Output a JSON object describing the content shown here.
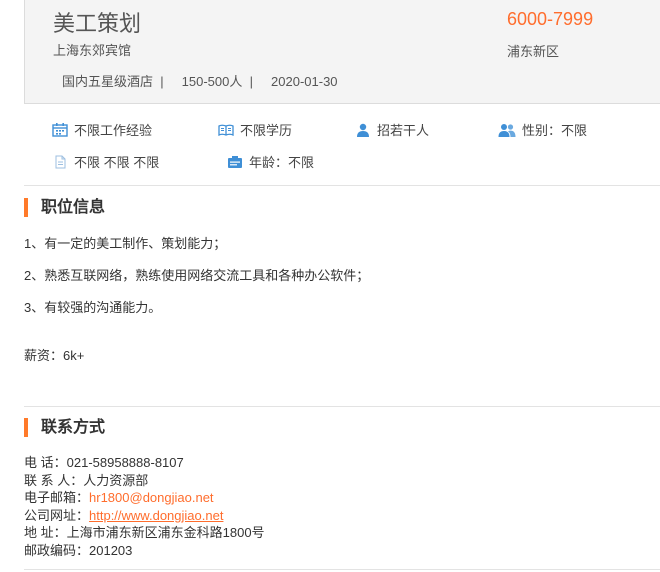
{
  "job": {
    "title": "美工策划",
    "company": "上海东郊宾馆",
    "meta_text": "国内五星级酒店  |     150-500人  |     2020-01-30",
    "salary": "6000-7999",
    "location": "浦东新区"
  },
  "requirements": [
    {
      "icon": "calendar-icon",
      "text": "不限工作经验"
    },
    {
      "icon": "book-icon",
      "text": "不限学历"
    },
    {
      "icon": "person-icon",
      "text": "招若干人"
    },
    {
      "icon": "people-icon",
      "text": "性别：不限"
    },
    {
      "icon": "document-icon",
      "text": "不限 不限 不限"
    },
    {
      "icon": "id-card-icon",
      "text": "年龄：不限"
    }
  ],
  "position": {
    "section_title": "职位信息",
    "lines": [
      "1、有一定的美工制作、策划能力；",
      "2、熟悉互联网络，熟练使用网络交流工具和各种办公软件；",
      "3、有较强的沟通能力。"
    ],
    "salary_line": "薪资：6k+"
  },
  "contact": {
    "section_title": "联系方式",
    "phone_label": "电 话：",
    "phone": "021-58958888-8107",
    "contact_label": "联 系 人：",
    "contact_person": "人力资源部",
    "email_label": "电子邮箱：",
    "email": "hr1800@dongjiao.net",
    "website_label": "公司网址：",
    "website": "http://www.dongjiao.net",
    "address_label": "地 址：",
    "address": "上海市浦东新区浦东金科路1800号",
    "postcode_label": "邮政编码：",
    "postcode": "201203"
  },
  "colors": {
    "accent": "#ff6d2d",
    "icon_blue": "#3f8fd6"
  }
}
